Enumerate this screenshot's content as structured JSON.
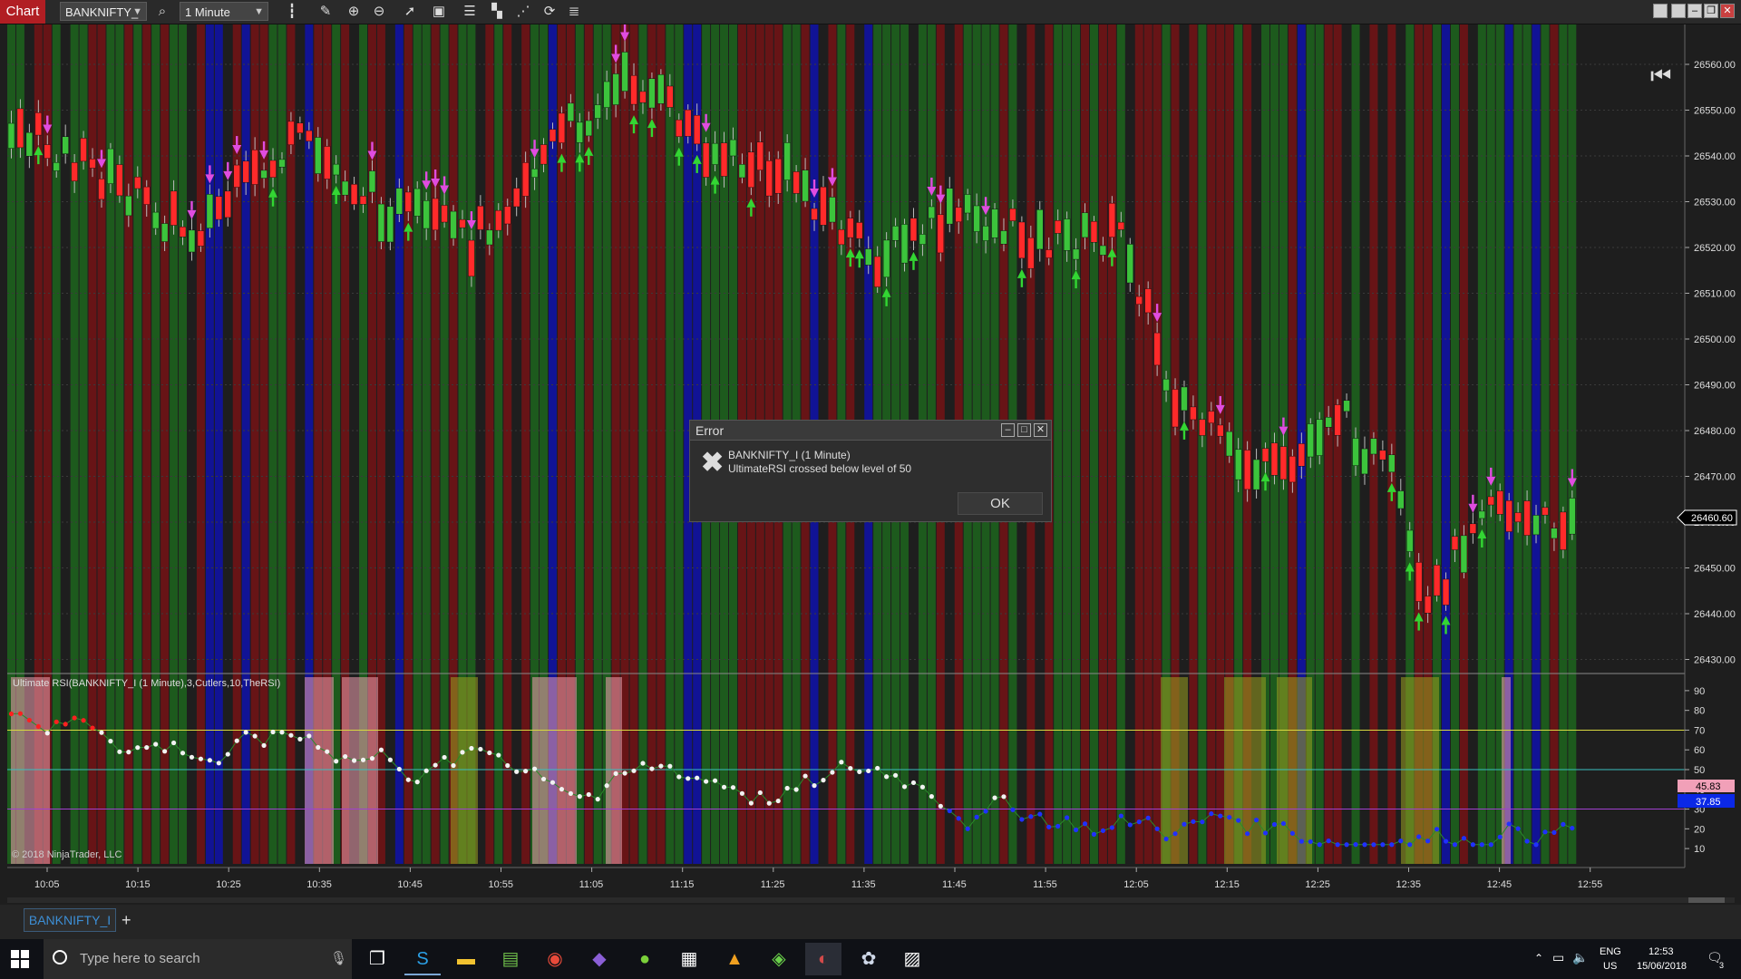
{
  "toolbar": {
    "chart_label": "Chart",
    "instrument": "BANKNIFTY_",
    "interval": "1 Minute"
  },
  "price_axis": {
    "labels": [
      "26560.00",
      "26550.00",
      "26540.00",
      "26530.00",
      "26520.00",
      "26510.00",
      "26500.00",
      "26490.00",
      "26480.00",
      "26470.00",
      "26460.00",
      "26450.00",
      "26440.00",
      "26430.00"
    ],
    "current_price": "26460.60"
  },
  "indicator": {
    "label": "Ultimate RSI(BANKNIFTY_I (1 Minute),3,Cutlers,10,TheRSI)",
    "axis_labels": [
      "90",
      "80",
      "70",
      "60",
      "50",
      "40",
      "30",
      "20",
      "10"
    ],
    "value_1": "45.83",
    "value_2": "37.85",
    "copyright": "© 2018 NinjaTrader, LLC"
  },
  "time_axis": {
    "labels": [
      "10:05",
      "10:15",
      "10:25",
      "10:35",
      "10:45",
      "10:55",
      "11:05",
      "11:15",
      "11:25",
      "11:35",
      "11:45",
      "11:55",
      "12:05",
      "12:15",
      "12:25",
      "12:35",
      "12:45",
      "12:55"
    ]
  },
  "dialog": {
    "title": "Error",
    "line1": "BANKNIFTY_I (1 Minute)",
    "line2": "UltimateRSI crossed below level of 50",
    "ok_label": "OK"
  },
  "tabs": {
    "instrument_tab": "BANKNIFTY_I",
    "add": "+"
  },
  "taskbar": {
    "search_placeholder": "Type here to search",
    "lang": "ENG",
    "region": "US",
    "time": "12:53",
    "date": "15/06/2018",
    "notifications": "3"
  },
  "colors": {
    "up_candle": "#3cc43c",
    "down_candle": "#ff2a2a",
    "band_red": "#6b1416",
    "band_green": "#1d5e1d",
    "band_blue": "#11139c"
  }
}
